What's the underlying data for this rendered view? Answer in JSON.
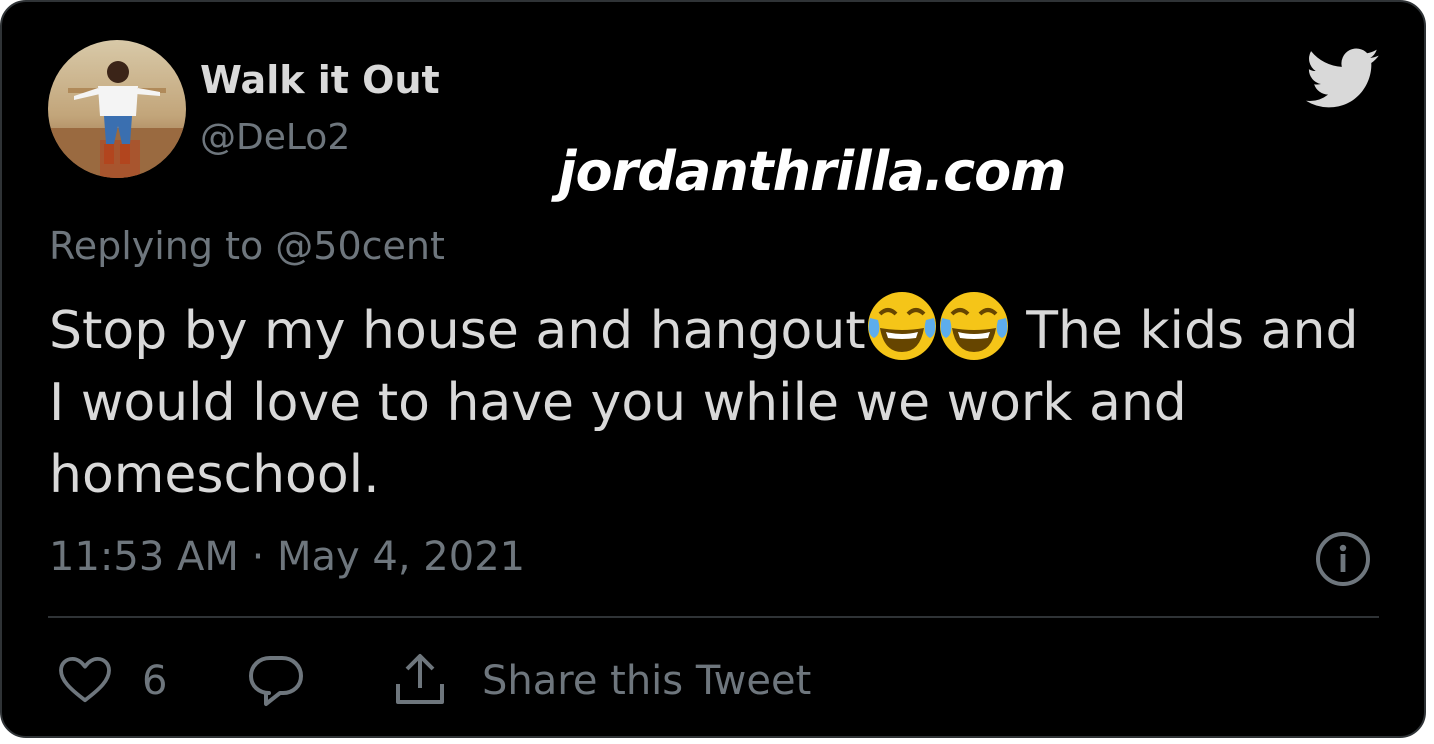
{
  "tweet": {
    "display_name": "Walk it Out",
    "handle": "@DeLo2",
    "reply_to": "Replying to @50cent",
    "text_part1": "Stop by my house and hangout",
    "text_part2": " The kids and I would love to have you while we work and homeschool.",
    "emojis": [
      "face-with-tears-of-joy",
      "face-with-tears-of-joy"
    ],
    "timestamp": "11:53 AM · May 4, 2021",
    "like_count": "6",
    "share_label": "Share this Tweet"
  },
  "watermark": "jordanthrilla.com",
  "icons": {
    "brand": "twitter-bird-icon",
    "info": "info-icon",
    "like": "heart-icon",
    "reply": "reply-icon",
    "share": "share-icon"
  },
  "colors": {
    "background": "#000000",
    "text": "#d9d9d9",
    "secondary_text": "#6e767d",
    "divider": "#2f3336",
    "emoji": "#f5c518"
  }
}
